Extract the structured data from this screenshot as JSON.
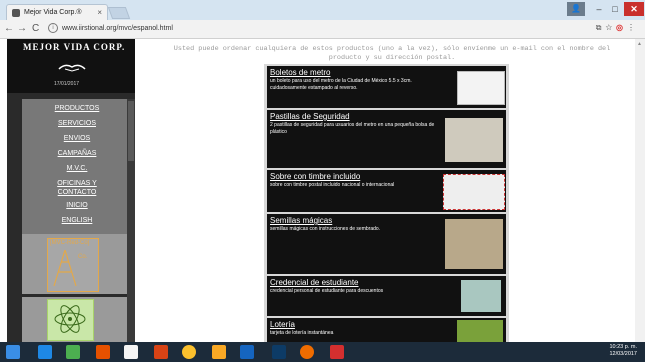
{
  "browser": {
    "tab_title": "Mejor Vida Corp.®",
    "tab_close": "×",
    "url": "www.iirstional.org/mvc/espanol.html",
    "controls": {
      "minimize": "–",
      "maximize": "□",
      "close": "✕"
    }
  },
  "sidebar": {
    "logo_text": "MEJOR VIDA CORP.",
    "logo_date": "17/01/2017",
    "menu": [
      {
        "label": "PRODUCTOS"
      },
      {
        "label": "SERVICIOS"
      },
      {
        "label": "ENVIOS"
      },
      {
        "label": "CAMPAÑAS"
      },
      {
        "label": "M.V.C."
      },
      {
        "label": "OFICINAS Y CONTACTO"
      },
      {
        "label": "INICIO"
      },
      {
        "label": "ENGLISH"
      }
    ],
    "badge_label": "[MVC-Red-Co]",
    "badge_co": "Co."
  },
  "note": "Usted puede ordenar cualquiera de estos productos (uno a la vez), sólo envíenme un e-mail con el nombre del producto y su dirección postal.",
  "products": [
    {
      "title": "Boletos de metro",
      "desc": "un boleto para uso del metro de la Ciudad de México 5.5 x 3cm. cuidadosamente estampado al reverso."
    },
    {
      "title": "Pastillas de Seguridad",
      "desc": "2 pastillas de seguridad para usuarios del metro en una pequeña bolsa de plástico"
    },
    {
      "title": "Sobre con timbre incluido",
      "desc": "sobre con timbre postal incluido nacional o internacional"
    },
    {
      "title": "Semillas mágicas",
      "desc": "semillas mágicas con instrucciones de sembrado."
    },
    {
      "title": "Credencial de estudiante",
      "desc": "credencial personal de estudiante para descuentos"
    },
    {
      "title": "Lotería",
      "desc": "tarjeta de lotería instantánea"
    }
  ],
  "taskbar": {
    "time": "10:23 p. m.",
    "date": "12/03/2017"
  }
}
